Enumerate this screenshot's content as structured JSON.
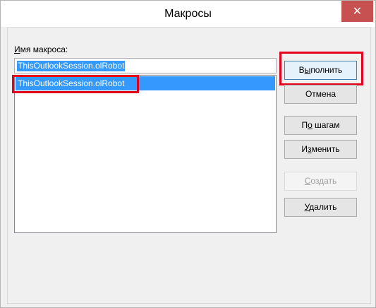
{
  "window": {
    "title": "Макросы",
    "close_glyph": "✕"
  },
  "form": {
    "label_prefix": "И",
    "label_rest": "мя макроса:",
    "name_value": "ThisOutlookSession.olRobot"
  },
  "list": {
    "items": [
      "ThisOutlookSession.olRobot"
    ]
  },
  "buttons": {
    "run": {
      "pre": "В",
      "u": "ы",
      "post": "полнить"
    },
    "cancel": "Отмена",
    "step": {
      "pre": "П",
      "u": "о",
      "post": " шагам"
    },
    "edit": {
      "pre": "И",
      "u": "з",
      "post": "менить"
    },
    "create": {
      "pre": "",
      "u": "С",
      "post": "оздать"
    },
    "delete": {
      "pre": "",
      "u": "У",
      "post": "далить"
    }
  },
  "colors": {
    "highlight": "#e2001a",
    "selection": "#3399ff",
    "close": "#c75050"
  }
}
